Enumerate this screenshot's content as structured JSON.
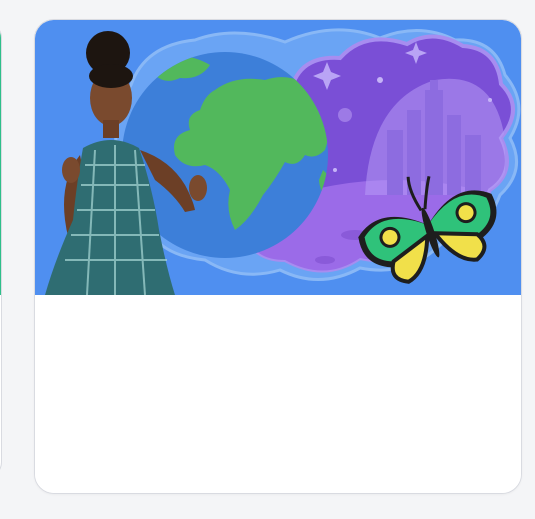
{
  "page": {
    "background_color": "#f4f5f7"
  },
  "previous_card": {
    "accent_color": "#2fbf8a"
  },
  "card": {
    "thumbnail": {
      "background_color": "#4f8ff0",
      "illustration": "person-with-globe-space-city-and-butterfly"
    },
    "colors": {
      "globe_ocean": "#3d7fd9",
      "globe_land": "#52b85c",
      "space": "#7a4fd6",
      "moon_surface": "#9b6be8",
      "butterfly_wing": "#2fc27a",
      "butterfly_spot": "#f1e04a"
    }
  }
}
